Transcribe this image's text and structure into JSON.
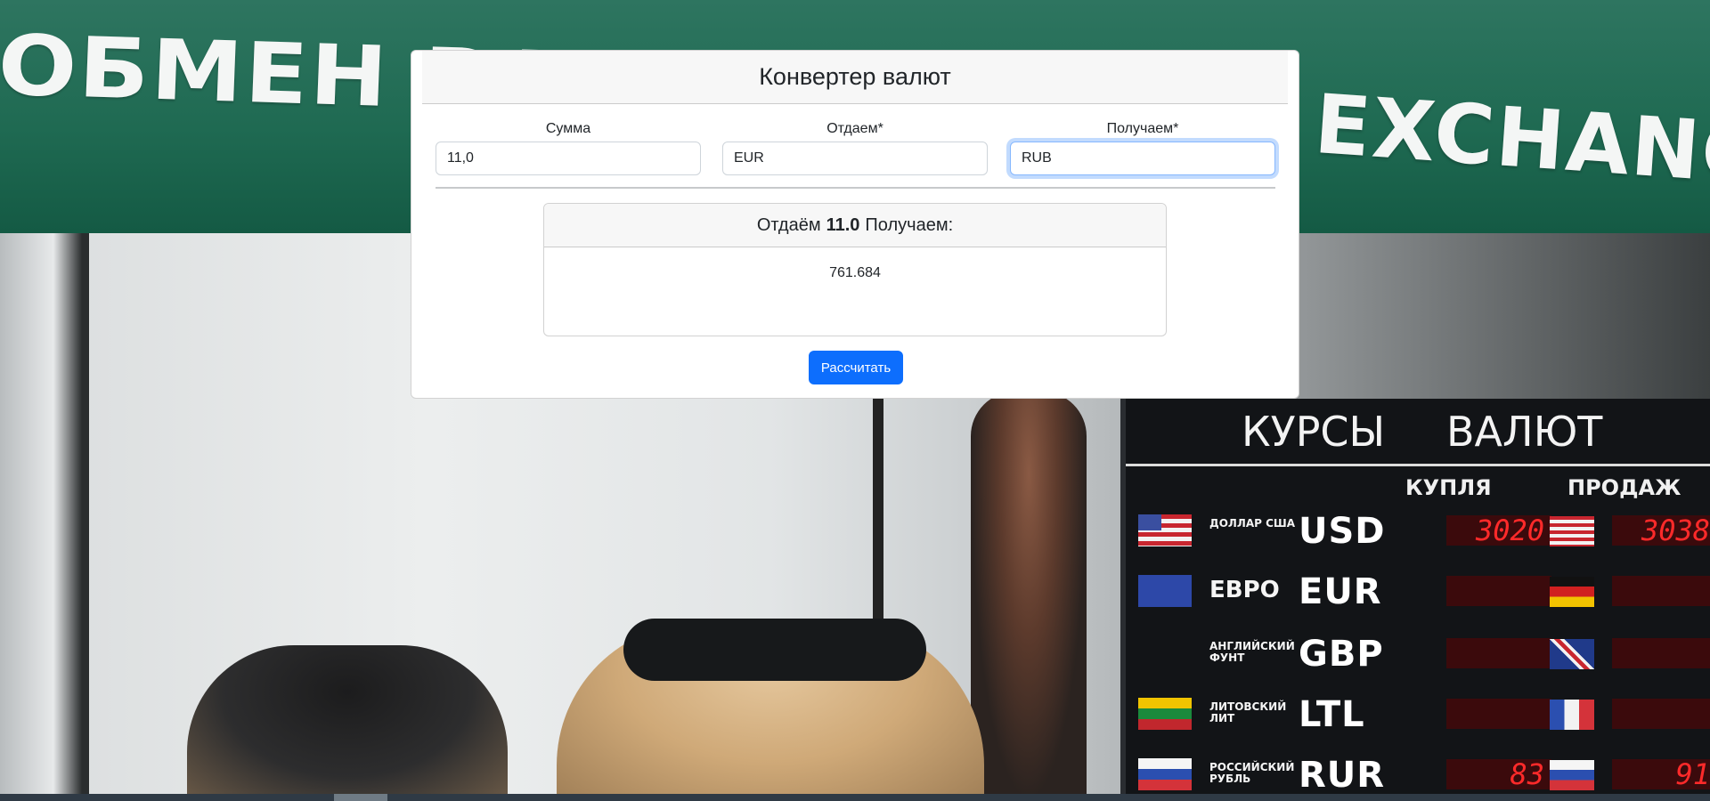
{
  "background": {
    "sign_ru": "ОБМЕН ВАЛЮТ",
    "sign_en": "EXCHANGE",
    "board": {
      "title_left": "КУРСЫ",
      "title_right": "ВАЛЮТ",
      "head_buy": "КУПЛЯ",
      "head_sell": "ПРОДАЖ",
      "rows": [
        {
          "name": "ДОЛЛАР США",
          "code": "USD",
          "buy": "3020",
          "sell": "3038"
        },
        {
          "name": "ЕВРО",
          "code": "EUR",
          "buy": "",
          "sell": ""
        },
        {
          "name": "АНГЛИЙСКИЙ ФУНТ",
          "code": "GBP",
          "buy": "",
          "sell": ""
        },
        {
          "name": "ЛИТОВСКИЙ ЛИТ",
          "code": "LTL",
          "buy": "",
          "sell": ""
        },
        {
          "name": "РОССИЙСКИЙ РУБЛЬ",
          "code": "RUR",
          "buy": "83",
          "sell": "91"
        }
      ]
    }
  },
  "converter": {
    "title": "Конвертер валют",
    "fields": {
      "amount": {
        "label": "Сумма",
        "value": "11,0"
      },
      "from": {
        "label": "Отдаем*",
        "value": "EUR"
      },
      "to": {
        "label": "Получаем*",
        "value": "RUB"
      }
    },
    "result": {
      "prefix": "Отдаём",
      "amount": "11.0",
      "suffix": "Получаем:",
      "value": "761.684"
    },
    "button_label": "Рассчитать"
  },
  "colors": {
    "primary": "#0d6efd",
    "focus_border": "#86b7fe",
    "led_red": "#ff2a2a"
  }
}
